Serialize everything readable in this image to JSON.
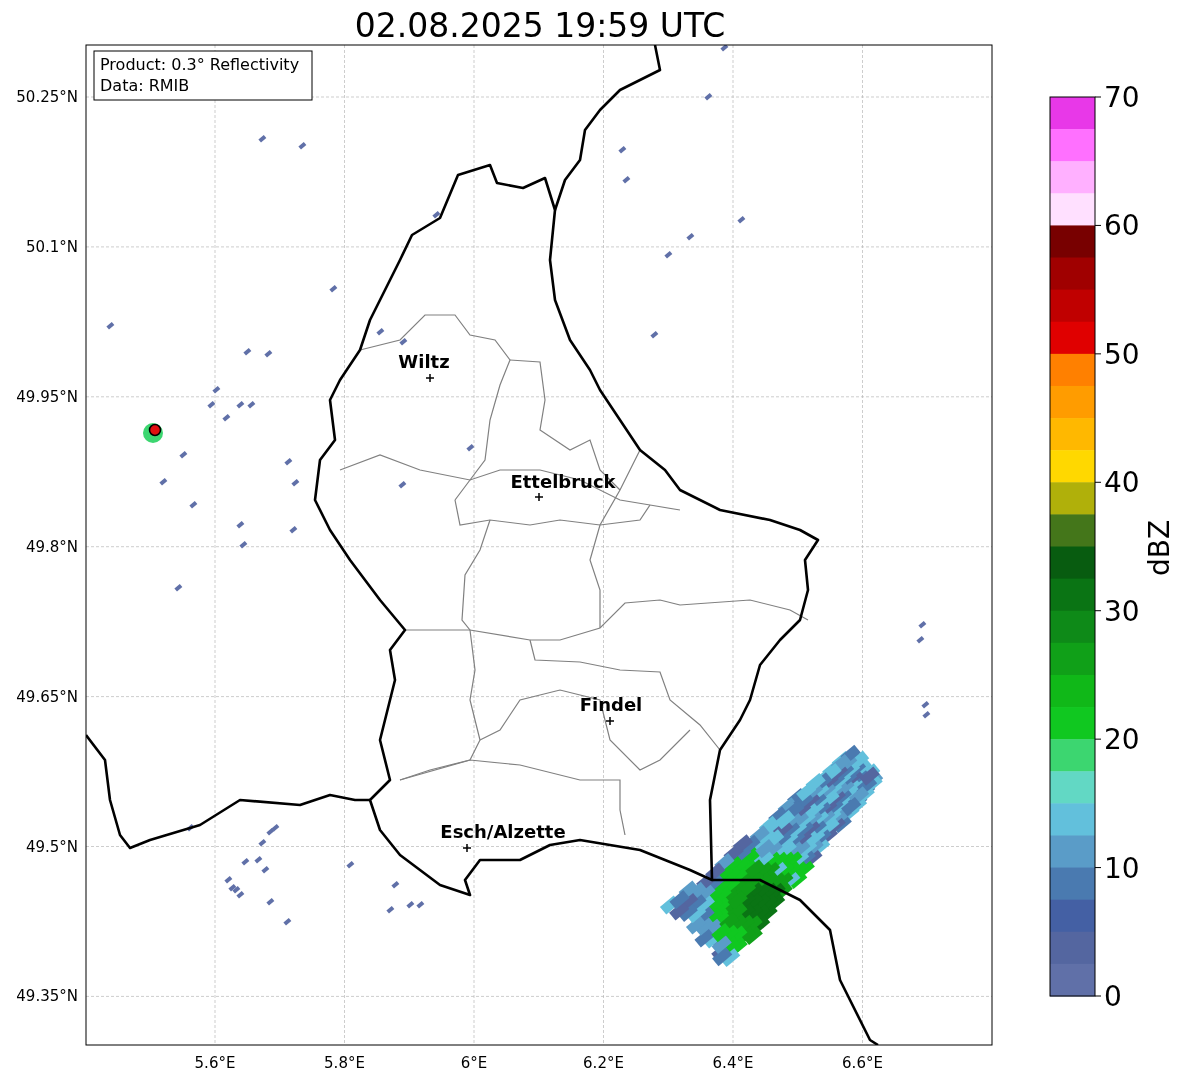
{
  "title": "02.08.2025 19:59 UTC",
  "info_box": {
    "lines": [
      "Product: 0.3° Reflectivity",
      "Data: RMIB"
    ]
  },
  "map": {
    "xtick_labels": [
      "5.6°E",
      "5.8°E",
      "6°E",
      "6.2°E",
      "6.4°E",
      "6.6°E"
    ],
    "ytick_labels": [
      "50.25°N",
      "50.1°N",
      "49.95°N",
      "49.8°N",
      "49.65°N",
      "49.5°N",
      "49.35°N"
    ],
    "cities": [
      {
        "name": "Wiltz"
      },
      {
        "name": "Ettelbruck"
      },
      {
        "name": "Findel"
      },
      {
        "name": "Esch/Alzette"
      }
    ]
  },
  "colorbar": {
    "label": "dBZ",
    "ticks": [
      "70",
      "60",
      "50",
      "40",
      "30",
      "20",
      "10",
      "0"
    ],
    "segments": [
      {
        "color": "#e838e8"
      },
      {
        "color": "#ff70ff"
      },
      {
        "color": "#ffb0ff"
      },
      {
        "color": "#ffe0ff"
      },
      {
        "color": "#780000"
      },
      {
        "color": "#a00000"
      },
      {
        "color": "#c00000"
      },
      {
        "color": "#e00000"
      },
      {
        "color": "#ff8000"
      },
      {
        "color": "#ff9c00"
      },
      {
        "color": "#ffb800"
      },
      {
        "color": "#ffd800"
      },
      {
        "color": "#b0b00a"
      },
      {
        "color": "#44761a"
      },
      {
        "color": "#085c10"
      },
      {
        "color": "#0a7414"
      },
      {
        "color": "#0e8a18"
      },
      {
        "color": "#10a018"
      },
      {
        "color": "#10b818"
      },
      {
        "color": "#10c820"
      },
      {
        "color": "#3cd670"
      },
      {
        "color": "#62d8c4"
      },
      {
        "color": "#62c0dc"
      },
      {
        "color": "#5a9cc8"
      },
      {
        "color": "#4a7ab0"
      },
      {
        "color": "#4460a4"
      },
      {
        "color": "#5466a0"
      },
      {
        "color": "#6070a8"
      }
    ]
  }
}
